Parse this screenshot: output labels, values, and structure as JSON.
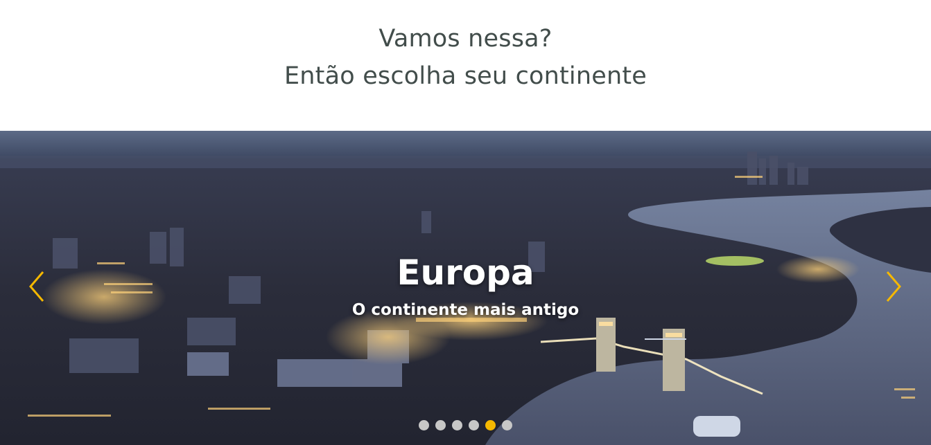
{
  "intro": {
    "line1": "Vamos nessa?",
    "line2": "Então escolha seu continente"
  },
  "carousel": {
    "title": "Europa",
    "subtitle": "O continente mais antigo",
    "prev_icon": "chevron-left-icon",
    "next_icon": "chevron-right-icon",
    "arrow_color": "#f5b800",
    "slide_count": 6,
    "active_slide": 5,
    "dot_color": "#c7c7c7",
    "dot_active_color": "#f5b800"
  }
}
